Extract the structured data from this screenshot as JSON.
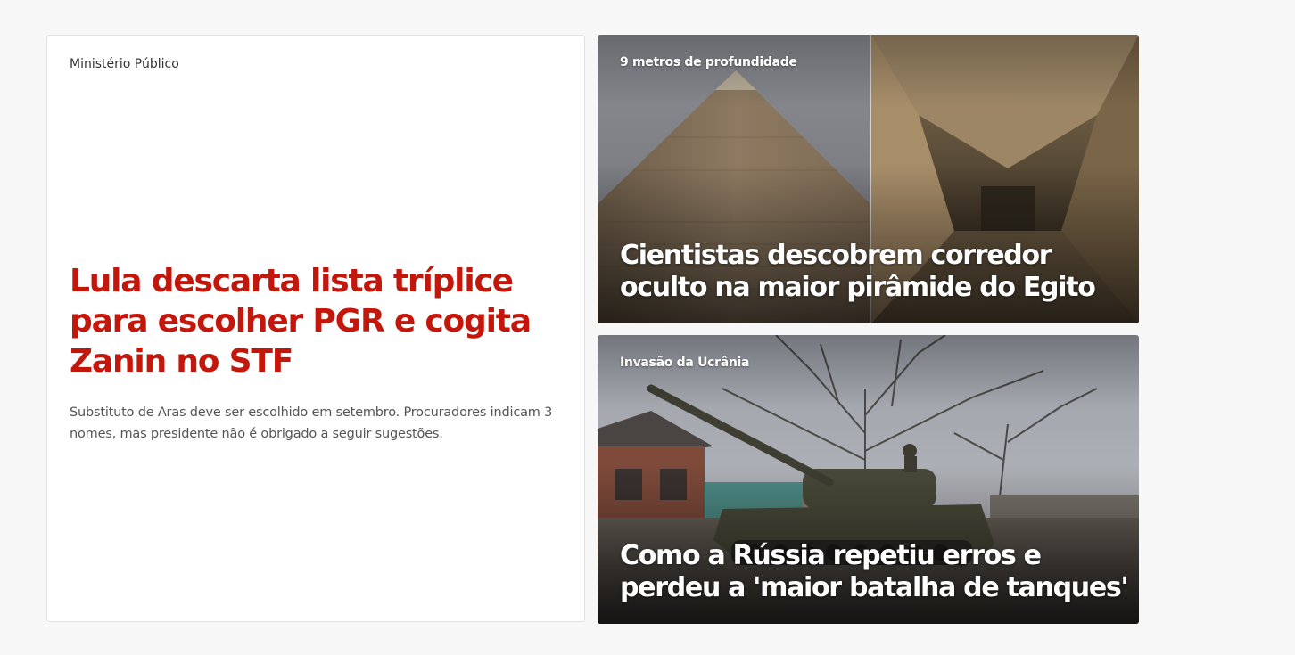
{
  "main_story": {
    "kicker": "Ministério Público",
    "headline": "Lula descarta lista tríplice para escolher PGR e cogita Zanin no STF",
    "summary": "Substituto de Aras deve ser escolhido em setembro. Procuradores indicam 3 nomes, mas presidente não é obrigado a seguir sugestões."
  },
  "side_stories": [
    {
      "kicker": "9 metros de profundidade",
      "title": "Cientistas descobrem corredor oculto na maior pirâmide do Egito",
      "image": "pyramid-and-corridor-photo"
    },
    {
      "kicker": "Invasão da Ucrânia",
      "title": "Como a Rússia repetiu erros e perdeu a 'maior batalha de tanques'",
      "image": "tank-in-village-photo"
    }
  ],
  "colors": {
    "headline_red": "#c4170c",
    "page_bg": "#f7f7f7"
  }
}
